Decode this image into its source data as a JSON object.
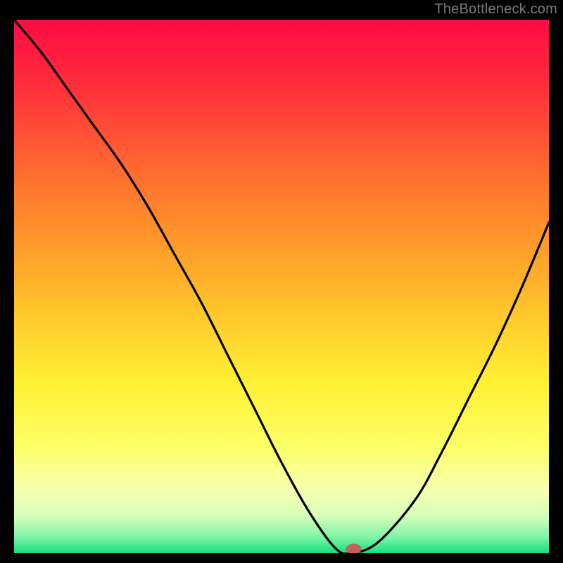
{
  "watermark": "TheBottleneck.com",
  "chart_data": {
    "type": "line",
    "title": "",
    "xlabel": "",
    "ylabel": "",
    "x": [
      0.0,
      0.05,
      0.1,
      0.15,
      0.2,
      0.25,
      0.3,
      0.35,
      0.4,
      0.45,
      0.5,
      0.55,
      0.6,
      0.63,
      0.68,
      0.75,
      0.8,
      0.85,
      0.9,
      0.95,
      1.0
    ],
    "values": [
      1.0,
      0.94,
      0.87,
      0.8,
      0.73,
      0.65,
      0.56,
      0.47,
      0.37,
      0.27,
      0.17,
      0.08,
      0.01,
      0.0,
      0.02,
      0.1,
      0.19,
      0.29,
      0.39,
      0.5,
      0.62
    ],
    "xlim": [
      0,
      1
    ],
    "ylim": [
      0,
      1
    ],
    "marker": {
      "x": 0.635,
      "y": 0.0
    },
    "gradient": {
      "stops": [
        {
          "offset": 0.0,
          "color": "#ff0a45"
        },
        {
          "offset": 0.12,
          "color": "#ff2d3b"
        },
        {
          "offset": 0.28,
          "color": "#ff6a2f"
        },
        {
          "offset": 0.42,
          "color": "#ff9a2a"
        },
        {
          "offset": 0.55,
          "color": "#ffc72b"
        },
        {
          "offset": 0.68,
          "color": "#fff033"
        },
        {
          "offset": 0.8,
          "color": "#fdff66"
        },
        {
          "offset": 0.88,
          "color": "#f7ffb0"
        },
        {
          "offset": 0.93,
          "color": "#d6ffb8"
        },
        {
          "offset": 0.97,
          "color": "#7ff3a8"
        },
        {
          "offset": 1.0,
          "color": "#12e07a"
        }
      ]
    }
  }
}
